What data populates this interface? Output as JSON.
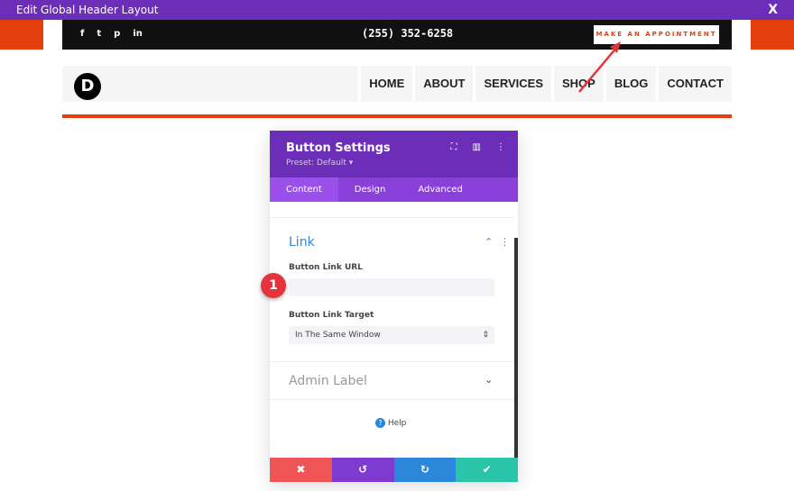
{
  "window": {
    "title": "Edit Global Header Layout",
    "close": "X"
  },
  "header": {
    "social": [
      "f",
      "t",
      "p",
      "in"
    ],
    "phone": "(255) 352-6258",
    "cta": "MAKE AN APPOINTMENT",
    "logo": "D",
    "nav": [
      "HOME",
      "ABOUT",
      "SERVICES",
      "SHOP",
      "BLOG",
      "CONTACT"
    ]
  },
  "modal": {
    "title": "Button Settings",
    "preset": "Preset: Default ▾",
    "tabs": [
      "Content",
      "Design",
      "Advanced"
    ],
    "link_section": "Link",
    "url_label": "Button Link URL",
    "url_value": "",
    "target_label": "Button Link Target",
    "target_value": "In The Same Window",
    "admin_label": "Admin Label",
    "help": "Help"
  },
  "step_badge": "1",
  "colors": {
    "purple": "#6c2eb9",
    "orange": "#e63f0f",
    "cancel": "#ef5555",
    "undo": "#7e3bd0",
    "redo": "#2b87da",
    "save": "#29c4a9"
  }
}
